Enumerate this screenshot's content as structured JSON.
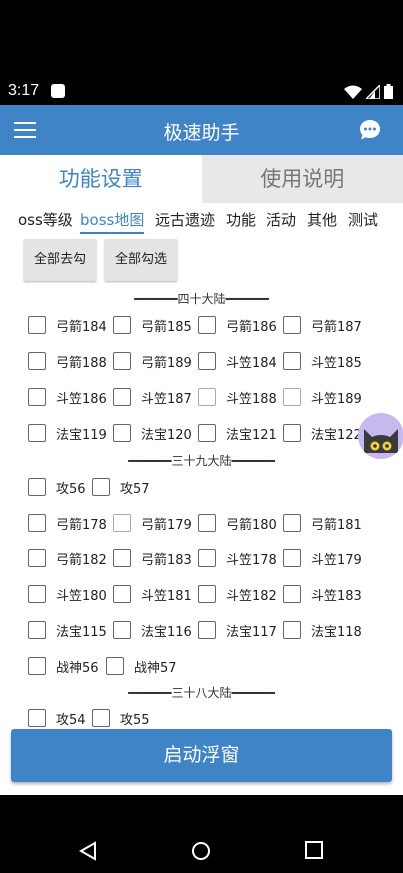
{
  "status": {
    "time": "3:17"
  },
  "appbar": {
    "title": "极速助手"
  },
  "tabs": {
    "settings": "功能设置",
    "help": "使用说明"
  },
  "subtabs": [
    "oss等级",
    "boss地图",
    "远古遗迹",
    "功能",
    "活动",
    "其他",
    "测试"
  ],
  "buttons": {
    "uncheck_all": "全部去勾",
    "check_all": "全部勾选",
    "start": "启动浮窗"
  },
  "sections": [
    {
      "title": "━━━━━━四十大陆━━━━━━",
      "rows": [
        [
          "弓箭184",
          "弓箭185",
          "弓箭186",
          "弓箭187"
        ],
        [
          "弓箭188",
          "弓箭189",
          "斗笠184",
          "斗笠185"
        ],
        [
          "斗笠186",
          "斗笠187",
          "斗笠188",
          "斗笠189"
        ],
        [
          "法宝119",
          "法宝120",
          "法宝121",
          "法宝122"
        ]
      ]
    },
    {
      "title": "━━━━━━三十九大陆━━━━━━",
      "rows": [
        [
          "攻56",
          "攻57"
        ],
        [
          "弓箭178",
          "弓箭179",
          "弓箭180",
          "弓箭181"
        ],
        [
          "弓箭182",
          "弓箭183",
          "斗笠178",
          "斗笠179"
        ],
        [
          "斗笠180",
          "斗笠181",
          "斗笠182",
          "斗笠183"
        ],
        [
          "法宝115",
          "法宝116",
          "法宝117",
          "法宝118"
        ],
        [
          "战神56",
          "战神57"
        ]
      ]
    },
    {
      "title": "━━━━━━三十八大陆━━━━━━",
      "rows": [
        [
          "攻54",
          "攻55"
        ]
      ]
    }
  ]
}
